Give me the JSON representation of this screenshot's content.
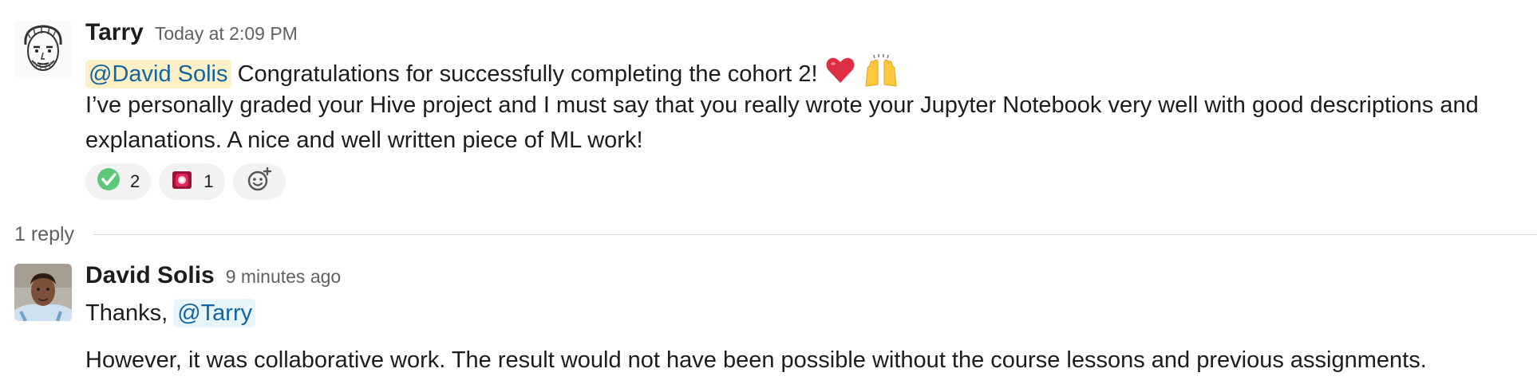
{
  "message1": {
    "author": "Tarry",
    "timestamp": "Today at 2:09 PM",
    "mention": "@David Solis",
    "line1_text": "Congratulations for successfully completing the cohort 2!",
    "line2": "I’ve personally graded your Hive project and I must say that you really wrote your Jupyter Notebook very well with good descriptions and",
    "line3": "explanations. A nice and well written piece of ML work!",
    "reactions": [
      {
        "icon": "check-mark-icon",
        "count": "2"
      },
      {
        "icon": "siren-icon",
        "count": "1"
      }
    ],
    "add_reaction_icon": "add-reaction-icon"
  },
  "thread": {
    "replies_label": "1 reply"
  },
  "message2": {
    "author": "David Solis",
    "timestamp": "9 minutes ago",
    "line1_text": "Thanks,",
    "mention": "@Tarry",
    "line2": "However, it was collaborative work. The result would not have been possible without the course lessons and previous assignments."
  },
  "colors": {
    "mention_text": "#1264a3",
    "mention_bg_highlight": "#fdf0c4",
    "mention_bg": "#e8f5fa",
    "reaction_bg": "#f2f2f2",
    "muted_text": "#616061"
  }
}
